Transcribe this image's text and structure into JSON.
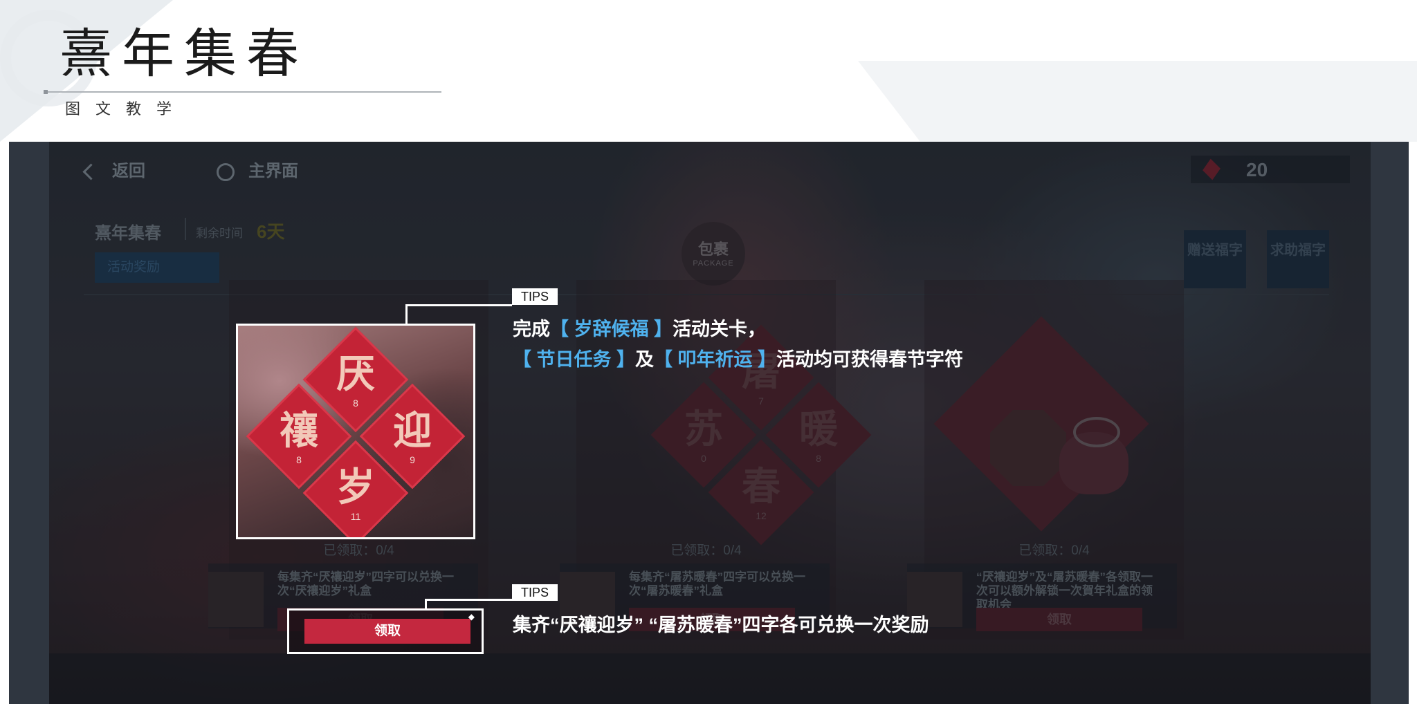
{
  "header": {
    "title": "熹年集春",
    "subtitle": "图文教学"
  },
  "game": {
    "topbar": {
      "back_label": "返回",
      "home_label": "主界面",
      "currency_value": "20"
    },
    "event": {
      "title": "熹年集春",
      "remaining_label": "剩余时间",
      "remaining_value": "6天",
      "tab_label": "活动奖励"
    },
    "package": {
      "label": "包裹",
      "sub": "PACKAGE"
    },
    "side_buttons": [
      "赠送福字",
      "求助福字"
    ],
    "card1": {
      "top": "厌",
      "left": "禳",
      "right": "迎",
      "bottom": "岁",
      "top_count": "8",
      "left_count": "8",
      "right_count": "9",
      "bottom_count": "11",
      "claimed": "已领取：0/4",
      "desc": "每集齐“厌禳迎岁”四字可以兑换一次“厌禳迎岁”礼盒",
      "button": "领取"
    },
    "card2": {
      "top": "屠",
      "left": "苏",
      "right": "暖",
      "bottom": "春",
      "top_count": "7",
      "left_count": "0",
      "right_count": "8",
      "bottom_count": "12",
      "claimed": "已领取：0/4",
      "desc": "每集齐“屠苏暖春”四字可以兑换一次“屠苏暖春”礼盒",
      "button": "领取"
    },
    "card3": {
      "claimed": "已领取：0/4",
      "desc": "“厌禳迎岁”及“屠苏暖春”各领取一次可以额外解锁一次賀年礼盒的领取机会",
      "button": "领取"
    }
  },
  "tips": {
    "tag": "TIPS",
    "tip1_a": "完成",
    "tip1_hl": "【 岁辞候福 】",
    "tip1_b": "活动关卡，",
    "tip2_hl1": "【 节日任务 】",
    "tip2_mid": "及",
    "tip2_hl2": "【 叩年祈运 】",
    "tip2_b": "活动均可获得春节字符",
    "tip3": "集齐“厌禳迎岁” “屠苏暖春”四字各可兑换一次奖励",
    "highlight_button": "领取"
  },
  "colors": {
    "accent_blue": "#4fb2ee",
    "fu_red": "#c32336",
    "claim_red": "#c4283f"
  }
}
